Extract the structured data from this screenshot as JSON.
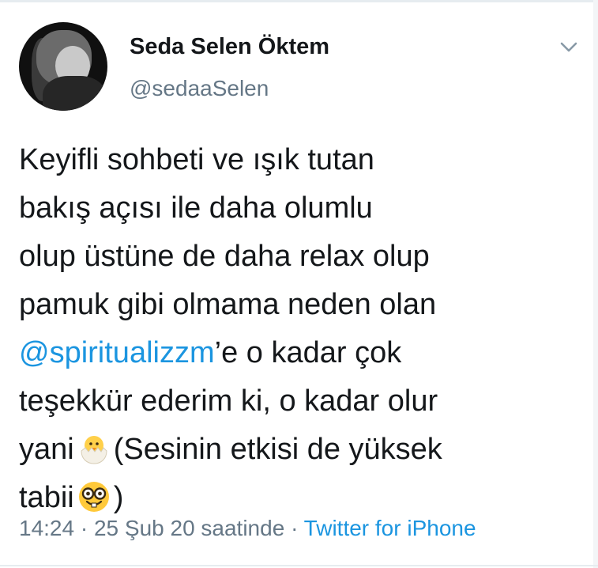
{
  "tweet": {
    "display_name": "Seda Selen Öktem",
    "handle": "@sedaaSelen",
    "text_lines": {
      "l1": "Keyifli sohbeti ve ışık tutan",
      "l2": "bakış açısı ile daha olumlu",
      "l3": "olup üstüne de daha relax olup",
      "l4": "pamuk gibi olmama neden olan",
      "l5_mention": "@spiritualizzm",
      "l5_rest": "’e o kadar çok",
      "l6": "teşekkür ederim ki, o kadar olur",
      "l7_before": "yani",
      "l7_after": "(Sesinin etkisi de yüksek",
      "l8_before": "tabii",
      "l8_after": ")"
    },
    "emojis": [
      "hatching-chick-emoji",
      "nerd-face-emoji"
    ],
    "time": "14:24",
    "separator": "·",
    "date": "25 Şub 20 saatinde",
    "source": "Twitter for iPhone"
  },
  "colors": {
    "text": "#14171a",
    "secondary": "#657786",
    "link": "#1b95e0",
    "border": "#e6ecf0"
  },
  "icons": {
    "menu": "chevron-down-icon"
  }
}
